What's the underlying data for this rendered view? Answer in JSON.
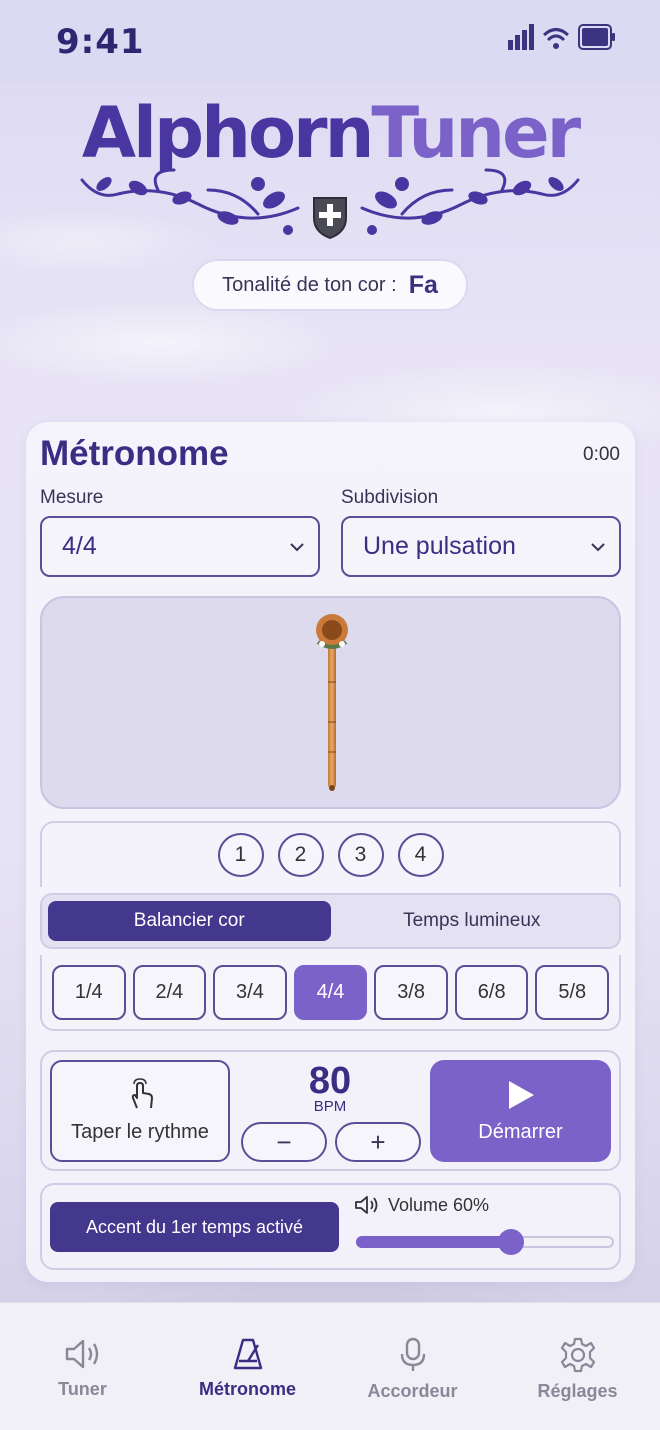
{
  "status_bar": {
    "time": "9:41"
  },
  "app": {
    "logo_part1": "Alphorn",
    "logo_part2": "Tuner"
  },
  "key": {
    "label": "Tonalité de ton cor :",
    "value": "Fa"
  },
  "metronome": {
    "title": "Métronome",
    "timer": "0:00",
    "measure_label": "Mesure",
    "measure_value": "4/4",
    "subdivision_label": "Subdivision",
    "subdivision_value": "Une pulsation",
    "beats": [
      "1",
      "2",
      "3",
      "4"
    ],
    "modes": [
      {
        "label": "Balancier cor",
        "active": true
      },
      {
        "label": "Temps lumineux",
        "active": false
      }
    ],
    "signatures": [
      "1/4",
      "2/4",
      "3/4",
      "4/4",
      "3/8",
      "6/8",
      "5/8"
    ],
    "active_signature": "4/4",
    "tap_label": "Taper le rythme",
    "bpm": "80",
    "bpm_unit": "BPM",
    "minus": "−",
    "plus": "+",
    "start_label": "Démarrer",
    "accent_label": "Accent du 1er temps activé",
    "volume_label": "Volume 60%",
    "volume_value": 60
  },
  "tabs": [
    {
      "label": "Tuner",
      "icon": "speaker-icon",
      "active": false
    },
    {
      "label": "Métronome",
      "icon": "metronome-icon",
      "active": true
    },
    {
      "label": "Accordeur",
      "icon": "microphone-icon",
      "active": false
    },
    {
      "label": "Réglages",
      "icon": "gear-icon",
      "active": false
    }
  ],
  "colors": {
    "primary": "#44378e",
    "accent": "#7a62c9",
    "text": "#3a2d84"
  }
}
